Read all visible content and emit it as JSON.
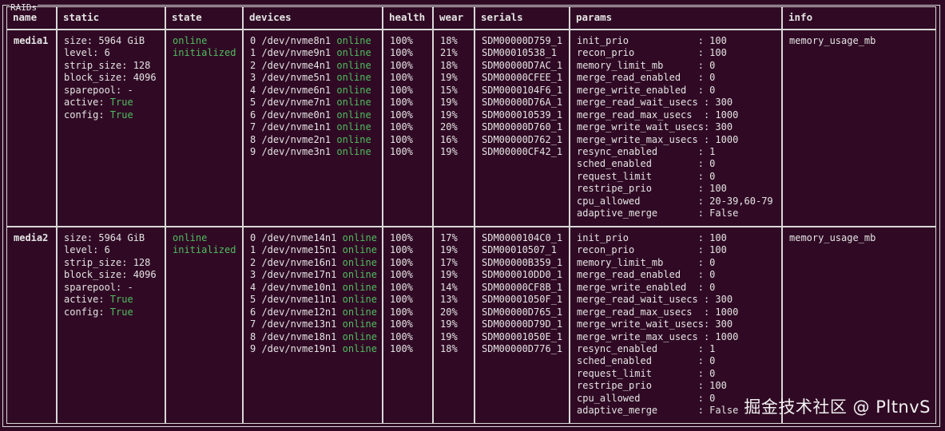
{
  "panel": {
    "title": "RAIDs"
  },
  "headers": [
    "name",
    "static",
    "state",
    "devices",
    "health",
    "wear",
    "serials",
    "params",
    "info"
  ],
  "rows": [
    {
      "name": "media1",
      "static": [
        {
          "k": "size: ",
          "v": "5964 GiB",
          "hl": false
        },
        {
          "k": "level: ",
          "v": "6",
          "hl": false
        },
        {
          "k": "strip_size: ",
          "v": "128",
          "hl": false
        },
        {
          "k": "block_size: ",
          "v": "4096",
          "hl": false
        },
        {
          "k": "sparepool: ",
          "v": "-",
          "hl": false
        },
        {
          "k": "active: ",
          "v": "True",
          "hl": true
        },
        {
          "k": "config: ",
          "v": "True",
          "hl": true
        }
      ],
      "state": [
        "online",
        "initialized"
      ],
      "devices": [
        {
          "dev": "0 /dev/nvme8n1 ",
          "status": "online"
        },
        {
          "dev": "1 /dev/nvme9n1 ",
          "status": "online"
        },
        {
          "dev": "2 /dev/nvme4n1 ",
          "status": "online"
        },
        {
          "dev": "3 /dev/nvme5n1 ",
          "status": "online"
        },
        {
          "dev": "4 /dev/nvme6n1 ",
          "status": "online"
        },
        {
          "dev": "5 /dev/nvme7n1 ",
          "status": "online"
        },
        {
          "dev": "6 /dev/nvme0n1 ",
          "status": "online"
        },
        {
          "dev": "7 /dev/nvme1n1 ",
          "status": "online"
        },
        {
          "dev": "8 /dev/nvme2n1 ",
          "status": "online"
        },
        {
          "dev": "9 /dev/nvme3n1 ",
          "status": "online"
        }
      ],
      "health": [
        "100%",
        "100%",
        "100%",
        "100%",
        "100%",
        "100%",
        "100%",
        "100%",
        "100%",
        "100%"
      ],
      "wear": [
        "18%",
        "21%",
        "18%",
        "19%",
        "15%",
        "19%",
        "19%",
        "20%",
        "16%",
        "19%"
      ],
      "serials": [
        "SDM00000D759_1",
        "SDM00010538_1",
        "SDM00000D7AC_1",
        "SDM00000CFEE_1",
        "SDM0000104F6_1",
        "SDM00000D76A_1",
        "SDM000010539_1",
        "SDM00000D760_1",
        "SDM00000D762_1",
        "SDM00000CF42_1"
      ],
      "params": [
        "init_prio            : 100",
        "recon_prio           : 100",
        "memory_limit_mb      : 0",
        "merge_read_enabled   : 0",
        "merge_write_enabled  : 0",
        "merge_read_wait_usecs : 300",
        "merge_read_max_usecs  : 1000",
        "merge_write_wait_usecs: 300",
        "merge_write_max_usecs : 1000",
        "resync_enabled       : 1",
        "sched_enabled        : 0",
        "request_limit        : 0",
        "restripe_prio        : 100",
        "cpu_allowed          : 20-39,60-79",
        "adaptive_merge       : False"
      ],
      "info": [
        "memory_usage_mb             : -"
      ]
    },
    {
      "name": "media2",
      "static": [
        {
          "k": "size: ",
          "v": "5964 GiB",
          "hl": false
        },
        {
          "k": "level: ",
          "v": "6",
          "hl": false
        },
        {
          "k": "strip_size: ",
          "v": "128",
          "hl": false
        },
        {
          "k": "block_size: ",
          "v": "4096",
          "hl": false
        },
        {
          "k": "sparepool: ",
          "v": "-",
          "hl": false
        },
        {
          "k": "active: ",
          "v": "True",
          "hl": true
        },
        {
          "k": "config: ",
          "v": "True",
          "hl": true
        }
      ],
      "state": [
        "online",
        "initialized"
      ],
      "devices": [
        {
          "dev": "0 /dev/nvme14n1 ",
          "status": "online"
        },
        {
          "dev": "1 /dev/nvme15n1 ",
          "status": "online"
        },
        {
          "dev": "2 /dev/nvme16n1 ",
          "status": "online"
        },
        {
          "dev": "3 /dev/nvme17n1 ",
          "status": "online"
        },
        {
          "dev": "4 /dev/nvme10n1 ",
          "status": "online"
        },
        {
          "dev": "5 /dev/nvme11n1 ",
          "status": "online"
        },
        {
          "dev": "6 /dev/nvme12n1 ",
          "status": "online"
        },
        {
          "dev": "7 /dev/nvme13n1 ",
          "status": "online"
        },
        {
          "dev": "8 /dev/nvme18n1 ",
          "status": "online"
        },
        {
          "dev": "9 /dev/nvme19n1 ",
          "status": "online"
        }
      ],
      "health": [
        "100%",
        "100%",
        "100%",
        "100%",
        "100%",
        "100%",
        "100%",
        "100%",
        "100%",
        "100%"
      ],
      "wear": [
        "17%",
        "19%",
        "17%",
        "19%",
        "14%",
        "13%",
        "20%",
        "19%",
        "19%",
        "18%"
      ],
      "serials": [
        "SDM0000104C0_1",
        "SDM00010507_1",
        "SDM00000B359_1",
        "SDM000010DD0_1",
        "SDM00000CF8B_1",
        "SDM00001050F_1",
        "SDM00000D765_1",
        "SDM00000D79D_1",
        "SDM00001050E_1",
        "SDM00000D776_1"
      ],
      "params": [
        "init_prio            : 100",
        "recon_prio           : 100",
        "memory_limit_mb      : 0",
        "merge_read_enabled   : 0",
        "merge_write_enabled  : 0",
        "merge_read_wait_usecs : 300",
        "merge_read_max_usecs  : 1000",
        "merge_write_wait_usecs: 300",
        "merge_write_max_usecs : 1000",
        "resync_enabled       : 1",
        "sched_enabled        : 0",
        "request_limit        : 0",
        "restripe_prio        : 100",
        "cpu_allowed          : 0",
        "adaptive_merge       : False"
      ],
      "info": [
        "memory_usage_mb             : -"
      ]
    }
  ],
  "watermark": "掘金技术社区 @ PltnvS",
  "colors": {
    "background": "#300a24",
    "text": "#e4e4e4",
    "ok": "#4fbd60",
    "border": "#d8d8d8"
  }
}
